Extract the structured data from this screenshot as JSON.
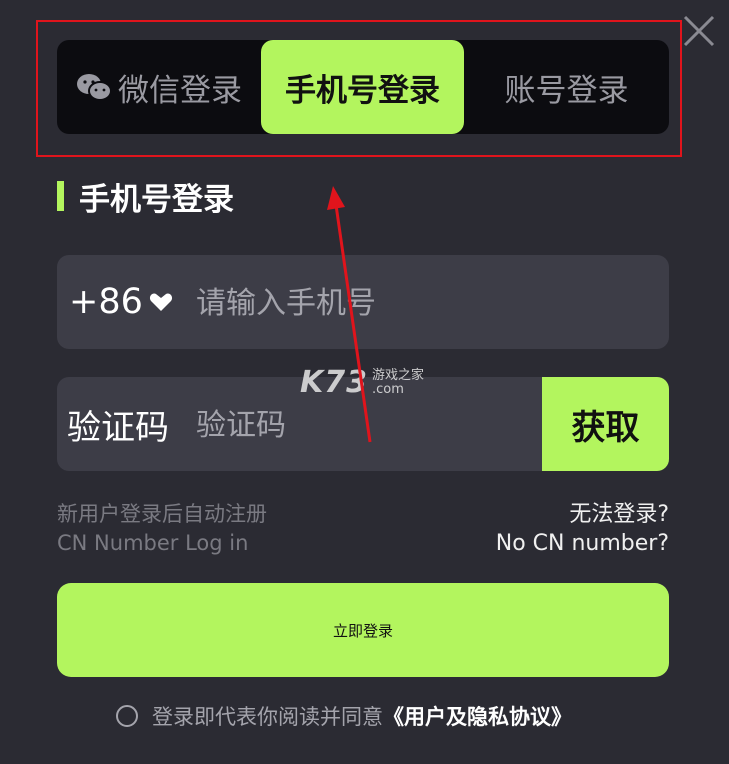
{
  "tabs": {
    "wechat": "微信登录",
    "phone": "手机号登录",
    "account": "账号登录"
  },
  "section_title": "手机号登录",
  "phone": {
    "country_code": "+86",
    "placeholder": "请输入手机号"
  },
  "verification": {
    "label": "验证码",
    "placeholder": "验证码",
    "get_button": "获取"
  },
  "hints": {
    "new_user_line1": "新用户登录后自动注册",
    "new_user_line2": "CN Number Log in",
    "cannot_login": "无法登录?",
    "no_cn_number": "No CN number?"
  },
  "login_button": "立即登录",
  "agreement": {
    "text": "登录即代表你阅读并同意",
    "link": "《用户及隐私协议》"
  },
  "watermark": {
    "main": "K73",
    "cn": "游戏之家",
    "domain": ".com"
  },
  "colors": {
    "accent": "#b3f55e",
    "background": "#2b2b33",
    "annotation_red": "#e0141c"
  }
}
